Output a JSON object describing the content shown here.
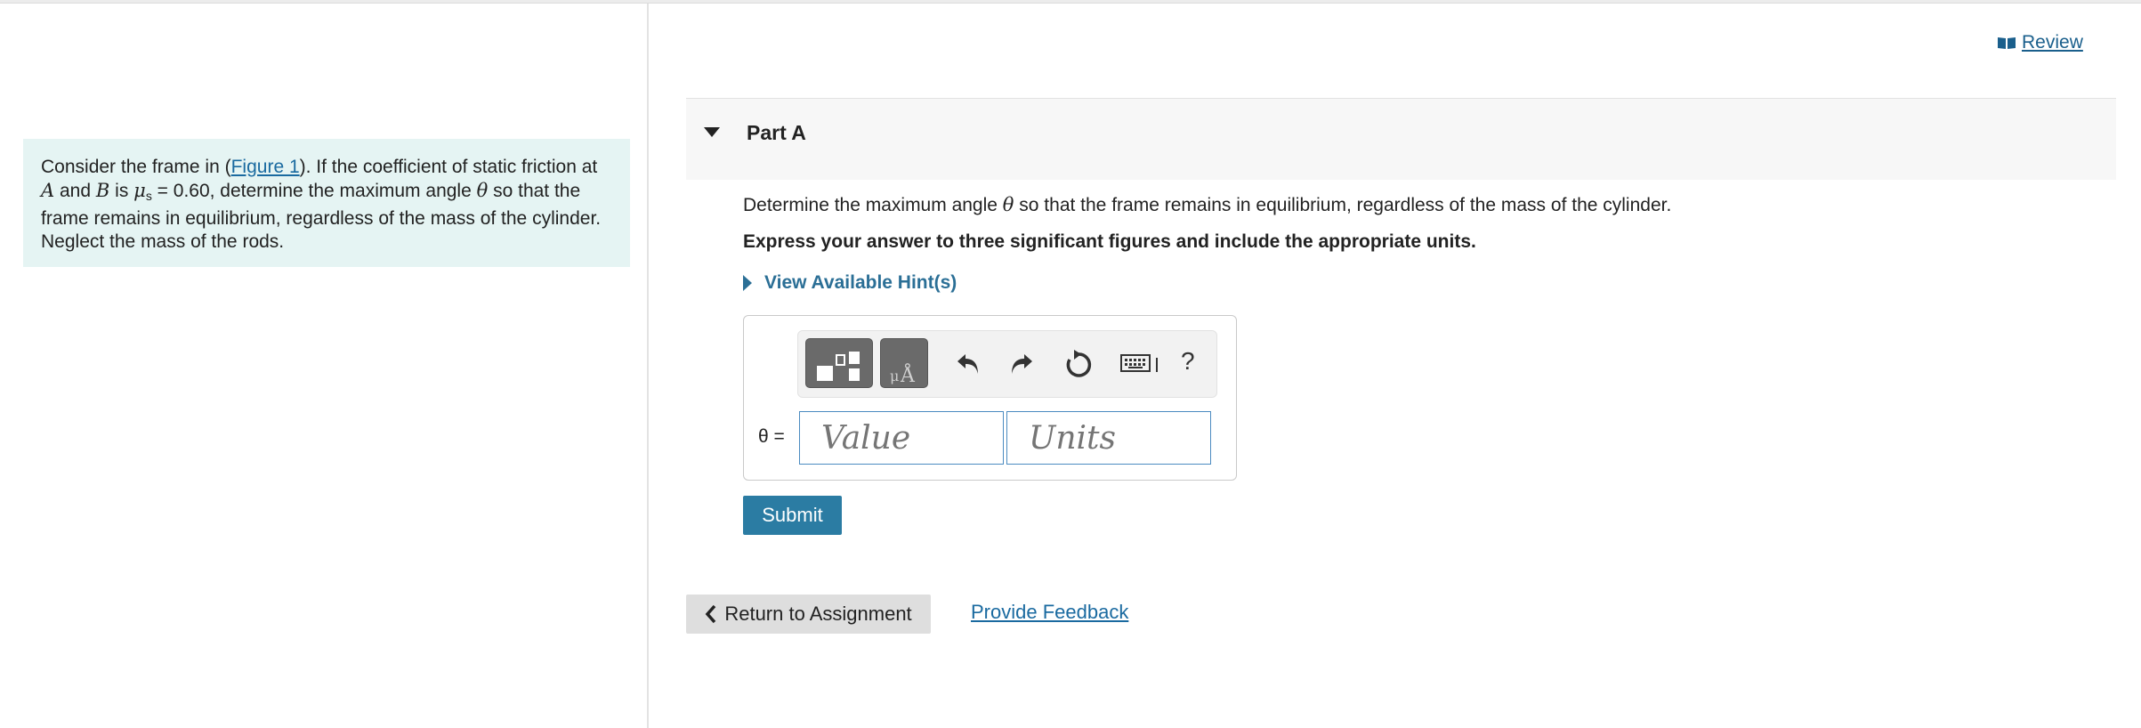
{
  "problem": {
    "text_consider": "Consider the frame in (",
    "figure_link": "Figure 1",
    "text_after_link": "). If the coefficient of static friction at",
    "point_a": "A",
    "text_and": " and ",
    "point_b": "B",
    "text_is": " is ",
    "mu": "μ",
    "mu_sub": "s",
    "text_mu_value": " = 0.60, determine the maximum angle ",
    "theta": "θ",
    "text_rest": " so that the frame remains in equilibrium, regardless of the mass of the cylinder. Neglect the mass of the rods."
  },
  "review": {
    "label": " Review",
    "icon": "book-icon"
  },
  "part": {
    "title": "Part A",
    "question_before": "Determine the maximum angle ",
    "question_theta": "θ",
    "question_after": " so that the frame remains in equilibrium, regardless of the mass of the cylinder.",
    "instruction": "Express your answer to three significant figures and include the appropriate units.",
    "hints_label": "View Available Hint(s)"
  },
  "answer": {
    "variable_label": "θ =",
    "value_placeholder": "Value",
    "units_placeholder": "Units",
    "help_label": "?"
  },
  "toolbar_icons": [
    "templates-icon",
    "units-icon",
    "undo-icon",
    "redo-icon",
    "reset-icon",
    "keyboard-icon",
    "help-icon"
  ],
  "buttons": {
    "submit": "Submit",
    "return": "Return to Assignment",
    "feedback": "Provide Feedback"
  },
  "colors": {
    "problem_bg": "#e5f4f3",
    "link": "#1a6aa0",
    "submit_bg": "#2b7ca3",
    "hint": "#2b6f96",
    "field_border": "#4b8bc0"
  }
}
